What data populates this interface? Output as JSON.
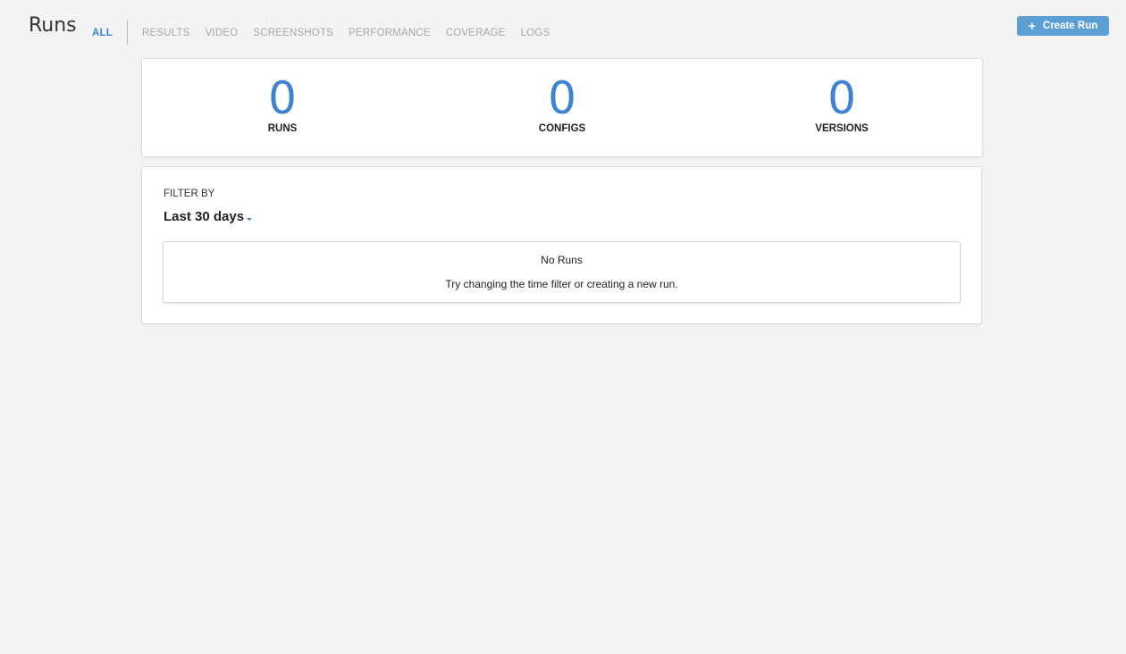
{
  "header": {
    "title": "Runs",
    "tabs": [
      {
        "label": "ALL",
        "active": true
      },
      {
        "label": "RESULTS",
        "active": false
      },
      {
        "label": "VIDEO",
        "active": false
      },
      {
        "label": "SCREENSHOTS",
        "active": false
      },
      {
        "label": "PERFORMANCE",
        "active": false
      },
      {
        "label": "COVERAGE",
        "active": false
      },
      {
        "label": "LOGS",
        "active": false
      }
    ],
    "create_button": {
      "icon": "plus-icon",
      "label": "Create Run"
    }
  },
  "stats": [
    {
      "value": "0",
      "label": "RUNS"
    },
    {
      "value": "0",
      "label": "CONFIGS"
    },
    {
      "value": "0",
      "label": "VERSIONS"
    }
  ],
  "filter": {
    "label": "FILTER BY",
    "selected": "Last 30 days"
  },
  "empty_state": {
    "title": "No Runs",
    "description": "Try changing the time filter or creating a new run."
  },
  "colors": {
    "accent": "#3e83cf",
    "button": "#5b9fd4",
    "background": "#f3f3f5",
    "inactive_tab": "#a7a7ad"
  }
}
